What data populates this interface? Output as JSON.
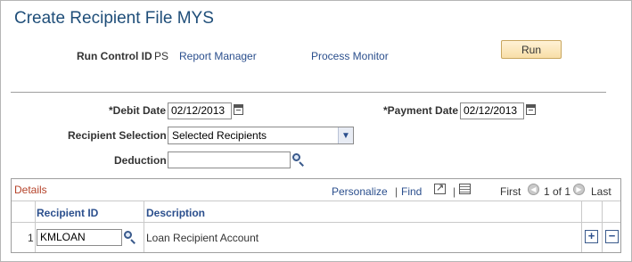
{
  "page": {
    "title": "Create Recipient File MYS"
  },
  "run_bar": {
    "run_control_label": "Run Control ID",
    "run_control_value": "PS",
    "report_manager_link": "Report Manager",
    "process_monitor_link": "Process Monitor",
    "run_button": "Run"
  },
  "form": {
    "debit_date_label": "*Debit Date",
    "debit_date_value": "02/12/2013",
    "payment_date_label": "*Payment Date",
    "payment_date_value": "02/12/2013",
    "recipient_selection_label": "Recipient Selection",
    "recipient_selection_value": "Selected Recipients",
    "deduction_label": "Deduction",
    "deduction_value": ""
  },
  "grid": {
    "title": "Details",
    "personalize_link": "Personalize",
    "find_link": "Find",
    "separator": "|",
    "first_label": "First",
    "page_info": "1 of 1",
    "last_label": "Last",
    "columns": [
      "Recipient ID",
      "Description"
    ],
    "rows": [
      {
        "num": "1",
        "recipient_id": "KMLOAN",
        "description": "Loan Recipient Account"
      }
    ],
    "add_row": "+",
    "delete_row": "−"
  },
  "icons": {
    "calendar": "calendar-icon",
    "lookup": "magnifier-icon",
    "dropdown": "chevron-down-icon",
    "zoom": "view-all-icon",
    "download": "download-excel-icon",
    "prev": "previous-arrow-icon",
    "next": "next-arrow-icon"
  },
  "colors": {
    "title": "#1f4e79",
    "link": "#2b4f8d",
    "grid_title": "#b5432a",
    "run_button": "#f8dea7"
  }
}
